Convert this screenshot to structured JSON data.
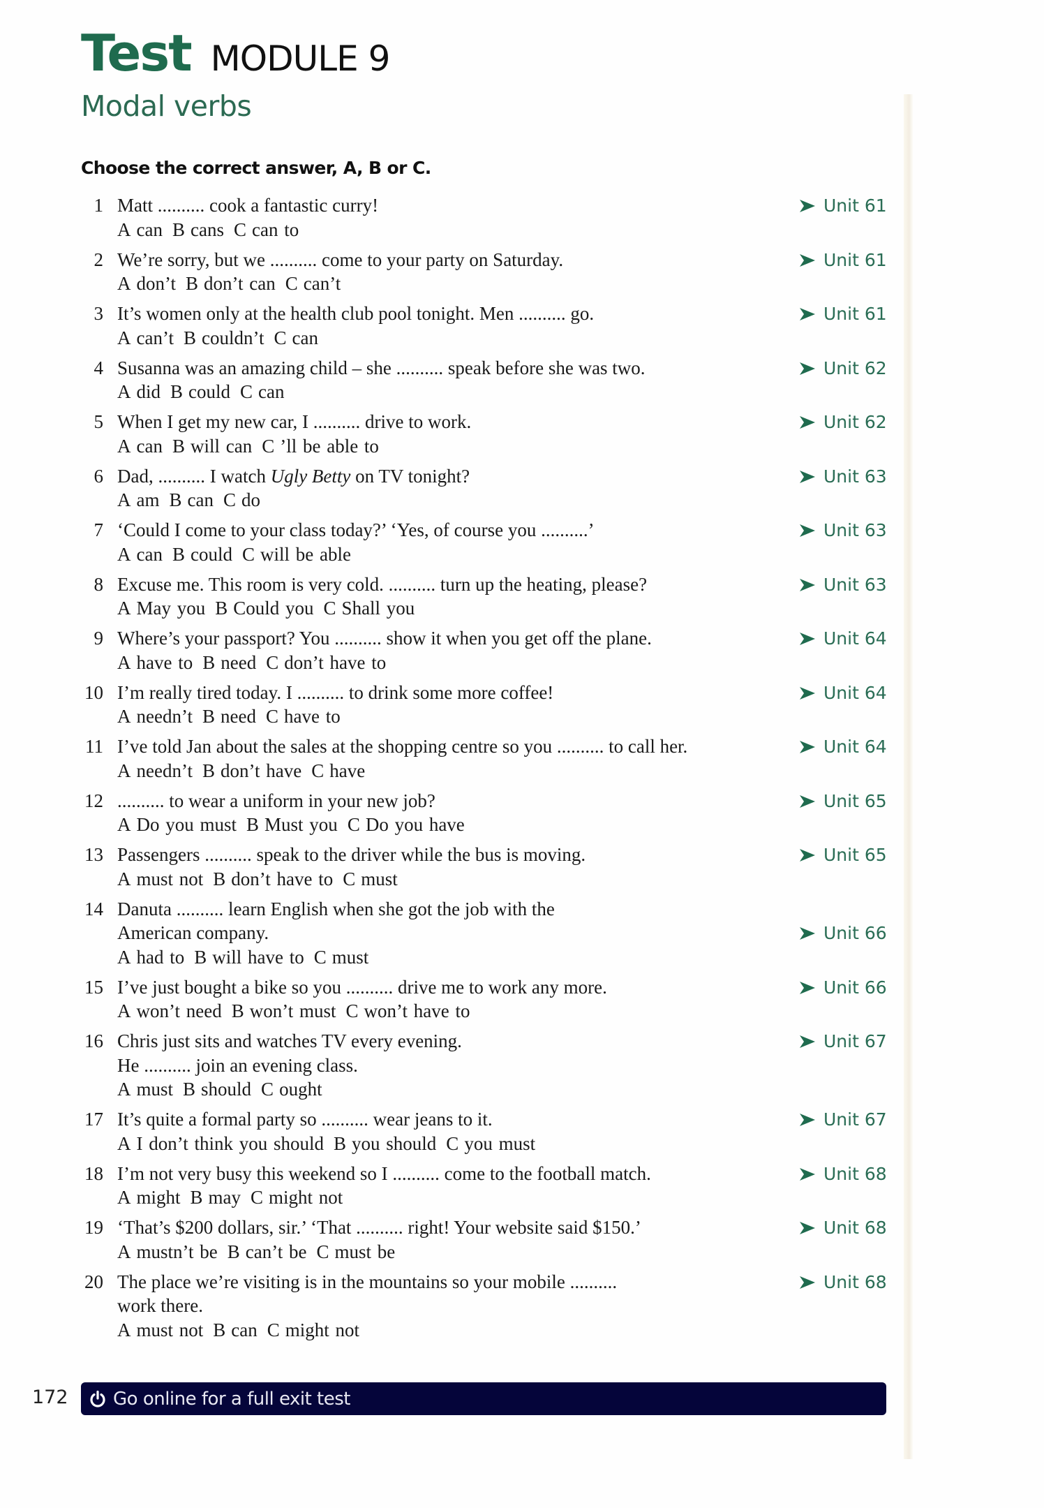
{
  "header": {
    "title_word": "Test",
    "module": "MODULE 9",
    "subtitle": "Modal verbs",
    "instruction": "Choose the correct answer, A, B or C."
  },
  "colors": {
    "accent_green": "#1f6b4e",
    "footer_navy": "#05053a"
  },
  "unit_prefix_icon": "arrowhead-right-icon",
  "questions": [
    {
      "number": "1",
      "lines": [
        "Matt .......... cook a fantastic curry!"
      ],
      "unit_line": 0,
      "options": [
        "can",
        "cans",
        "can to"
      ],
      "unit": "Unit 61"
    },
    {
      "number": "2",
      "lines": [
        "We’re sorry, but we .......... come to your party on Saturday."
      ],
      "unit_line": 0,
      "options": [
        "don’t",
        "don’t can",
        "can’t"
      ],
      "unit": "Unit 61"
    },
    {
      "number": "3",
      "lines": [
        "It’s women only at the health club pool tonight. Men .......... go."
      ],
      "unit_line": 0,
      "options": [
        "can’t",
        "couldn’t",
        "can"
      ],
      "unit": "Unit 61"
    },
    {
      "number": "4",
      "lines": [
        "Susanna was an amazing child – she .......... speak before she was two."
      ],
      "unit_line": 0,
      "options": [
        "did",
        "could",
        "can"
      ],
      "unit": "Unit 62"
    },
    {
      "number": "5",
      "lines": [
        "When I get my new car, I .......... drive to work."
      ],
      "unit_line": 0,
      "options": [
        "can",
        "will can",
        "’ll be able to"
      ],
      "unit": "Unit 62"
    },
    {
      "number": "6",
      "lines": [
        "Dad, .......... I watch Ugly Betty on TV tonight?"
      ],
      "italic": "Ugly Betty",
      "unit_line": 0,
      "options": [
        "am",
        "can",
        "do"
      ],
      "unit": "Unit 63"
    },
    {
      "number": "7",
      "lines": [
        "‘Could I come to your class today?’ ‘Yes, of course you ..........’"
      ],
      "unit_line": 0,
      "options": [
        "can",
        "could",
        "will be able"
      ],
      "unit": "Unit 63"
    },
    {
      "number": "8",
      "lines": [
        "Excuse me. This room is very cold. .......... turn up the heating, please?"
      ],
      "unit_line": 0,
      "options": [
        "May you",
        "Could you",
        "Shall you"
      ],
      "unit": "Unit 63"
    },
    {
      "number": "9",
      "lines": [
        "Where’s your passport? You .......... show it when you get off the plane."
      ],
      "unit_line": 0,
      "options": [
        "have to",
        "need",
        "don’t have to"
      ],
      "unit": "Unit 64"
    },
    {
      "number": "10",
      "lines": [
        "I’m really tired today. I .......... to drink some more coffee!"
      ],
      "unit_line": 0,
      "options": [
        "needn’t",
        "need",
        "have to"
      ],
      "unit": "Unit 64"
    },
    {
      "number": "11",
      "lines": [
        "I’ve told Jan about the sales at the shopping centre so you .......... to call her."
      ],
      "unit_line": 0,
      "options": [
        "needn’t",
        "don’t have",
        "have"
      ],
      "unit": "Unit 64"
    },
    {
      "number": "12",
      "lines": [
        ".......... to wear a uniform in your new job?"
      ],
      "unit_line": 0,
      "options": [
        "Do you must",
        "Must you",
        "Do you have"
      ],
      "unit": "Unit 65"
    },
    {
      "number": "13",
      "lines": [
        "Passengers .......... speak to the driver while the bus is moving."
      ],
      "unit_line": 0,
      "options": [
        "must not",
        "don’t have to",
        "must"
      ],
      "unit": "Unit 65"
    },
    {
      "number": "14",
      "lines": [
        "Danuta .......... learn English when she got the job with the",
        "American company."
      ],
      "unit_line": 1,
      "options": [
        "had to",
        "will have to",
        "must"
      ],
      "unit": "Unit 66"
    },
    {
      "number": "15",
      "lines": [
        "I’ve just bought a bike so you .......... drive me to work any more."
      ],
      "unit_line": 0,
      "options": [
        "won’t need",
        "won’t must",
        "won’t have to"
      ],
      "unit": "Unit 66"
    },
    {
      "number": "16",
      "lines": [
        "Chris just sits and watches TV every evening.",
        "He .......... join an evening class."
      ],
      "unit_line": 0,
      "options": [
        "must",
        "should",
        "ought"
      ],
      "unit": "Unit 67"
    },
    {
      "number": "17",
      "lines": [
        "It’s quite a formal party so .......... wear jeans to it."
      ],
      "unit_line": 0,
      "options": [
        "I don’t think you should",
        "you should",
        "you must"
      ],
      "unit": "Unit 67"
    },
    {
      "number": "18",
      "lines": [
        "I’m not very busy this weekend so I .......... come to the football match."
      ],
      "unit_line": 0,
      "options": [
        "might",
        "may",
        "might not"
      ],
      "unit": "Unit 68"
    },
    {
      "number": "19",
      "lines": [
        "‘That’s $200 dollars, sir.’ ‘That .......... right! Your website said $150.’"
      ],
      "unit_line": 0,
      "options": [
        "mustn’t be",
        "can’t be",
        "must be"
      ],
      "unit": "Unit 68"
    },
    {
      "number": "20",
      "lines": [
        "The place we’re visiting is in the mountains so your mobile ..........",
        "work there."
      ],
      "unit_line": 0,
      "options": [
        "must not",
        "can",
        "might not"
      ],
      "unit": "Unit 68"
    }
  ],
  "option_letters": [
    "A",
    "B",
    "C"
  ],
  "footer": {
    "page_number": "172",
    "icon": "power-icon",
    "banner_text": "Go online for a full exit test"
  }
}
